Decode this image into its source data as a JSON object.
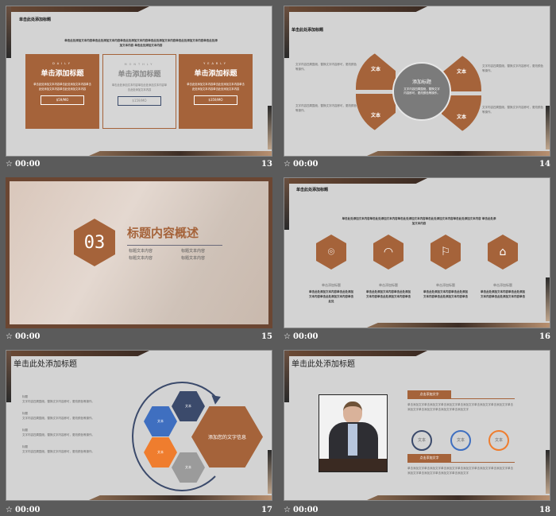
{
  "slides": [
    {
      "number": "13",
      "time": "00:00",
      "title": "单击此处添加标题",
      "intro": "单击此处添加文本内容单击此处添加文本内容单击此处添加文本内容单击此处添加文本内容单击此处添加文本内容单击此处添加文本内容 单击此处添加文本内容",
      "cards": [
        {
          "period": "DAILY",
          "heading": "单击添加标题",
          "body": "单击此处添加文本内容单击此处添加文本内容单击此处添加文本内容单击此处添加文本内容",
          "price": "$59/MO"
        },
        {
          "period": "MONTHLY",
          "heading": "单击添加标题",
          "body": "单击此处添加文本内容单击此处添加文本内容单击此处添加文本内容",
          "price": "$159/MO"
        },
        {
          "period": "YEARLY",
          "heading": "单击添加标题",
          "body": "单击此处添加文本内容单击此处添加文本内容单击此处添加文本内容单击此处添加文本内容",
          "price": "$359/MO"
        }
      ]
    },
    {
      "number": "14",
      "time": "00:00",
      "title": "单击此处添加标题",
      "center_title": "添加标题",
      "center_body": "文字内容四周围绕，替换文字内容即可，更改颜色等操作。",
      "petal_label": "文本",
      "side_text": "文字内容四周围绕，替换文字内容即可，更改颜色等操作。"
    },
    {
      "number": "15",
      "time": "00:00",
      "section_number": "03",
      "section_title": "标题内容概述",
      "bullets": [
        "标题文本内容",
        "标题文本内容",
        "标题文本内容",
        "标题文本内容"
      ]
    },
    {
      "number": "16",
      "time": "00:00",
      "title": "单击此处添加标题",
      "intro": "单击此处添加文本内容单击此处添加文本内容单击此处添加文本内容单击此处添加文本内容单击此处添加文本内容 单击此处添加文本内容",
      "items": [
        {
          "icon": "location-pin-icon",
          "glyph": "⌾",
          "heading": "单击添加标题",
          "body": "单击此处添加文本内容单击此处添加文本内容单击此处添加文本内容单击此处"
        },
        {
          "icon": "chevron-up-circle-icon",
          "glyph": "◠",
          "heading": "单击添加标题",
          "body": "单击此处添加文本内容单击此处添加文本内容单击此处添加文本内容单击"
        },
        {
          "icon": "flag-icon",
          "glyph": "⚐",
          "heading": "单击添加标题",
          "body": "单击此处添加文本内容单击此处添加文本内容单击此处添加文本内容单击"
        },
        {
          "icon": "home-icon",
          "glyph": "⌂",
          "heading": "单击添加标题",
          "body": "单击此处添加文本内容单击此处添加文本内容单击此处添加文本内容单击"
        }
      ]
    },
    {
      "number": "17",
      "time": "00:00",
      "title": "单击此处添加标题",
      "blocks": [
        {
          "label": "标题",
          "text": "文字内容四周围绕，替换文字内容即可，更改颜色等操作。"
        },
        {
          "label": "标题",
          "text": "文字内容四周围绕，替换文字内容即可，更改颜色等操作。"
        },
        {
          "label": "标题",
          "text": "文字内容四周围绕，替换文字内容即可，更改颜色等操作。"
        },
        {
          "label": "标题",
          "text": "文字内容四周围绕，替换文字内容即可，更改颜色等操作。"
        }
      ],
      "hex_label": "文本",
      "main_hex": "添加您的文字信息"
    },
    {
      "number": "18",
      "time": "00:00",
      "title": "单击此处添加标题",
      "tag": "点击添加文字",
      "para": "单击添加文字单击添加文字单击添加文字单击添加文字单击添加文字单击添加文字单击添加文字单击添加文字单击添加文字单击添加文字",
      "circle_label": "文本"
    }
  ],
  "colors": {
    "brand": "#a5633a",
    "navy": "#3b4a6b",
    "blue": "#3f6fc0",
    "orange": "#ef7d2e",
    "gray": "#9b9b9b",
    "background": "#5b5b5b"
  }
}
